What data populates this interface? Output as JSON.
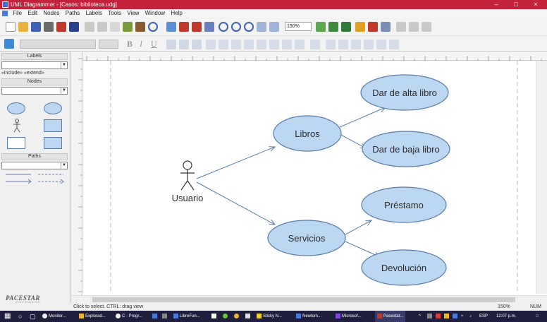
{
  "window": {
    "title": "UML Diagrammer - [Casos: biblioteca.udg]"
  },
  "menubar": {
    "items": [
      "File",
      "Edit",
      "Nodes",
      "Paths",
      "Labels",
      "Tools",
      "View",
      "Window",
      "Help"
    ]
  },
  "toolbar": {
    "zoom": "150%",
    "format_buttons": [
      "B",
      "I",
      "U"
    ]
  },
  "sidebar": {
    "labels_header": "Labels",
    "stereotypes": "«include» «extend»",
    "nodes_header": "Nodes",
    "paths_header": "Paths",
    "brand": "PACESTAR",
    "brand_sub": "SOFTWARE"
  },
  "diagram": {
    "actor": "Usuario",
    "nodes": {
      "libros": "Libros",
      "servicios": "Servicios",
      "alta": "Dar de alta libro",
      "baja": "Dar de baja libro",
      "prestamo": "Préstamo",
      "devolucion": "Devolución"
    }
  },
  "statusbar": {
    "hint": "Click to select. CTRL: drag view",
    "zoom": "150%",
    "mode": "NUM"
  },
  "taskbar": {
    "items": [
      "Monitor...",
      "Explorad...",
      "C - Progr...",
      "LibreFun...",
      "Sticky N...",
      "Newton\\...",
      "Microsof...",
      "Pacestar..."
    ],
    "lang": "ESP",
    "clock": "12:07 p.m."
  },
  "colors": {
    "titlebar": "#c4213a",
    "node_fill": "#bcd7f2",
    "node_stroke": "#5a7ea8",
    "taskbar": "#1f1f3d"
  }
}
